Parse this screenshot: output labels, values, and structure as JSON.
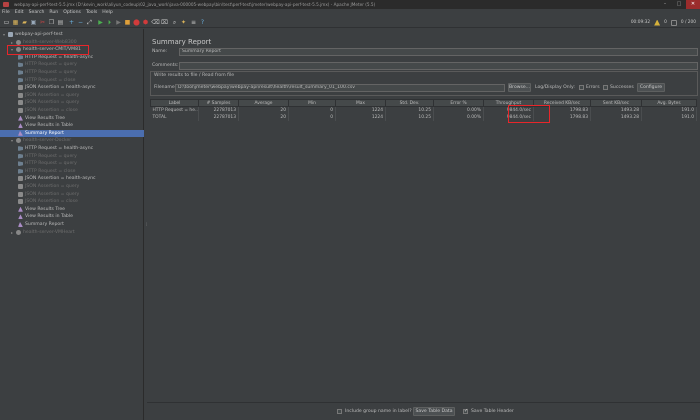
{
  "window": {
    "title": "webpay-api-perf-test-5.5.jmx (D:\\kevin_work\\aliyun_codeup\\02_java_work\\java-000005-webpay\\bin\\test\\perf-test\\jmeter\\webpay-api-perf-test-5.5.jmx) - Apache JMeter (5.5)",
    "min_glyph": "–",
    "max_glyph": "□",
    "close_glyph": "✕"
  },
  "menu": [
    "File",
    "Edit",
    "Search",
    "Run",
    "Options",
    "Tools",
    "Help"
  ],
  "toolbar": {
    "elapsed": "00:09:32",
    "warnings": "0",
    "threads": "0 / 200",
    "thread_limit": "200"
  },
  "tree": {
    "items": [
      {
        "label": "webpay-api-perf-test",
        "type": "plan",
        "indent": 0,
        "expanded": true,
        "disabled": false
      },
      {
        "label": "health-server-Web8300",
        "type": "tg",
        "indent": 1,
        "expanded": false,
        "disabled": true
      },
      {
        "label": "health-server-CMIT/VM81",
        "type": "tg",
        "indent": 1,
        "expanded": true,
        "disabled": false
      },
      {
        "label": "HTTP Request = health-async",
        "type": "sampler",
        "indent": 2,
        "disabled": false
      },
      {
        "label": "HTTP Request = query",
        "type": "sampler",
        "indent": 2,
        "disabled": true
      },
      {
        "label": "HTTP Request = query",
        "type": "sampler",
        "indent": 2,
        "disabled": true
      },
      {
        "label": "HTTP Request = close",
        "type": "sampler",
        "indent": 2,
        "disabled": true
      },
      {
        "label": "JSON Assertion = health-async",
        "type": "assert",
        "indent": 2,
        "disabled": false
      },
      {
        "label": "JSON Assertion = query",
        "type": "assert",
        "indent": 2,
        "disabled": true
      },
      {
        "label": "JSON Assertion = query",
        "type": "assert",
        "indent": 2,
        "disabled": true
      },
      {
        "label": "JSON Assertion = close",
        "type": "assert",
        "indent": 2,
        "disabled": true
      },
      {
        "label": "View Results Tree",
        "type": "listener",
        "indent": 2,
        "disabled": false
      },
      {
        "label": "View Results in Table",
        "type": "listener",
        "indent": 2,
        "disabled": false
      },
      {
        "label": "Summary Report",
        "type": "report",
        "indent": 2,
        "disabled": false,
        "selected": true
      },
      {
        "label": "health-server-Docker",
        "type": "tg",
        "indent": 1,
        "expanded": true,
        "disabled": true
      },
      {
        "label": "HTTP Request = health-async",
        "type": "sampler",
        "indent": 2,
        "disabled": false
      },
      {
        "label": "HTTP Request = query",
        "type": "sampler",
        "indent": 2,
        "disabled": true
      },
      {
        "label": "HTTP Request = query",
        "type": "sampler",
        "indent": 2,
        "disabled": true
      },
      {
        "label": "HTTP Request = close",
        "type": "sampler",
        "indent": 2,
        "disabled": true
      },
      {
        "label": "JSON Assertion = health-async",
        "type": "assert",
        "indent": 2,
        "disabled": false
      },
      {
        "label": "JSON Assertion = query",
        "type": "assert",
        "indent": 2,
        "disabled": true
      },
      {
        "label": "JSON Assertion = query",
        "type": "assert",
        "indent": 2,
        "disabled": true
      },
      {
        "label": "JSON Assertion = close",
        "type": "assert",
        "indent": 2,
        "disabled": true
      },
      {
        "label": "View Results Tree",
        "type": "listener",
        "indent": 2,
        "disabled": false
      },
      {
        "label": "View Results in Table",
        "type": "listener",
        "indent": 2,
        "disabled": false
      },
      {
        "label": "Summary Report",
        "type": "report",
        "indent": 2,
        "disabled": false
      },
      {
        "label": "health-server-VMHeart",
        "type": "tg",
        "indent": 1,
        "expanded": false,
        "disabled": true
      }
    ]
  },
  "report": {
    "title": "Summary Report",
    "name_label": "Name:",
    "name_value": "Summary Report",
    "comments_label": "Comments:",
    "comments_value": "",
    "group_title": "Write results to file / Read from file",
    "filename_label": "Filename",
    "filename_value": "D:\\tool\\jmeter\\webpay\\webpay-api\\result\\health\\result_summary_01_100.csv",
    "browse_label": "Browse...",
    "log_display_label": "Log/Display Only:",
    "errors_label": "Errors",
    "successes_label": "Successes",
    "configure_label": "Configure",
    "columns": [
      "Label",
      "# Samples",
      "Average",
      "Min",
      "Max",
      "Std. Dev.",
      "Error %",
      "Throughput",
      "Received KB/sec",
      "Sent KB/sec",
      "Avg. Bytes"
    ],
    "rows": [
      [
        "HTTP Request = he...",
        "22787013",
        "20",
        "0",
        "1224",
        "10.25",
        "0.00%",
        "9844.0/sec",
        "1798.83",
        "1493.28",
        "191.0"
      ],
      [
        "TOTAL",
        "22787013",
        "20",
        "0",
        "1224",
        "10.25",
        "0.00%",
        "9844.0/sec",
        "1798.83",
        "1493.28",
        "191.0"
      ]
    ],
    "include_group_label": "Include group name in label?",
    "save_table_label": "Save Table Data",
    "save_header_label": "Save Table Header"
  }
}
